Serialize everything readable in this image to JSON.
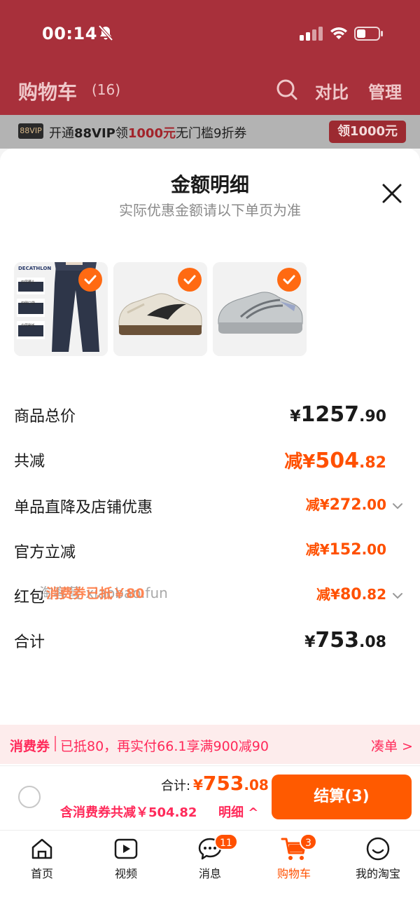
{
  "status_bar": {
    "time": "00:14"
  },
  "header": {
    "title": "购物车",
    "count": "(16)",
    "compare": "对比",
    "manage": "管理"
  },
  "vip_banner": {
    "badge": "88VIP",
    "text_prefix": "开通",
    "text_vip": "88VIP",
    "text_mid": "领",
    "text_amount": "1000元",
    "text_suffix": "无门槛9折券",
    "button": "领1000元"
  },
  "sheet": {
    "title": "金额明细",
    "subtitle": "实际优惠金额请以下单页为准",
    "products": [
      {
        "name": "decathlon-pants",
        "brand": "DECATHLON",
        "tags": [
          "双层腰头",
          "双侧口袋",
          "内层刷毛"
        ],
        "selected": true
      },
      {
        "name": "asics-sneaker-cream",
        "selected": true
      },
      {
        "name": "asics-running-shoe-grey",
        "selected": true
      }
    ],
    "rows": [
      {
        "label": "商品总价",
        "prefix": "¥",
        "int": "1257",
        "dec": ".90"
      },
      {
        "label": "共减",
        "prefix": "减¥",
        "int": "504",
        "dec": ".82"
      },
      {
        "label": "单品直降及店铺优惠",
        "prefix": "减¥",
        "int": "272",
        "dec": ".00"
      },
      {
        "label": "官方立减",
        "prefix": "减¥",
        "int": "152",
        "dec": ".00"
      },
      {
        "label": "红包",
        "prefix": "减¥",
        "int": "80",
        "dec": ".82",
        "overlay": "消费券已抵￥80",
        "watermark": "淘客营 xiaobao.fun"
      },
      {
        "label": "合计",
        "prefix": "¥",
        "int": "753",
        "dec": ".08"
      }
    ]
  },
  "coupon_bar": {
    "tag": "消费券",
    "text": "已抵80，再实付66.1享满900减90",
    "link": "凑单 >"
  },
  "checkout": {
    "total_label": "合计:",
    "total_prefix": "¥",
    "total_int": "753",
    "total_dec": ".08",
    "discount_text": "含消费券共减￥504.82",
    "detail_link": "明细 ^",
    "pay_button": "结算(3)"
  },
  "tabbar": {
    "items": [
      {
        "label": "首页",
        "icon": "home-icon"
      },
      {
        "label": "视频",
        "icon": "video-icon"
      },
      {
        "label": "消息",
        "icon": "message-icon",
        "badge": "11"
      },
      {
        "label": "购物车",
        "icon": "cart-icon",
        "badge": "3",
        "active": true
      },
      {
        "label": "我的淘宝",
        "icon": "profile-icon"
      }
    ]
  },
  "colors": {
    "accent": "#ff5000",
    "coupon": "#ff2a5a",
    "header": "#a8303b"
  }
}
